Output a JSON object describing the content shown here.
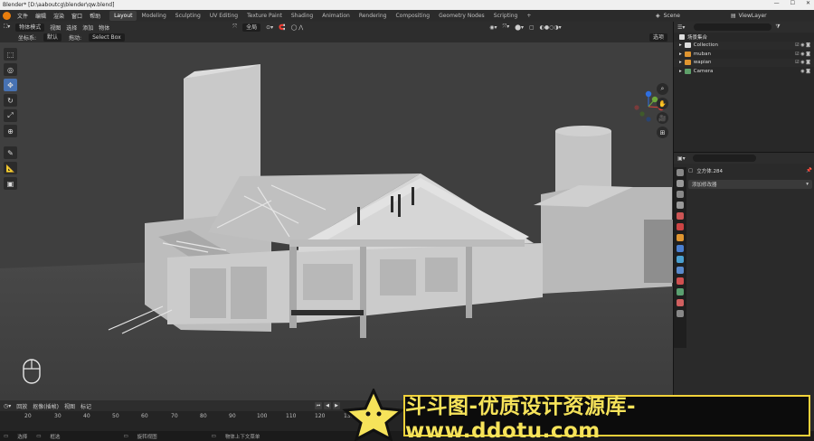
{
  "window": {
    "title": "Blender* [D:\\aaboutcg\\blender\\qw.blend]",
    "controls": [
      "—",
      "☐",
      "✕"
    ]
  },
  "menu": {
    "items": [
      "文件",
      "编辑",
      "渲染",
      "窗口",
      "帮助"
    ],
    "workspaces": [
      "Layout",
      "Modeling",
      "Sculpting",
      "UV Editing",
      "Texture Paint",
      "Shading",
      "Animation",
      "Rendering",
      "Compositing",
      "Geometry Nodes",
      "Scripting"
    ],
    "active_workspace": "Layout",
    "add_tab": "+",
    "scene": "Scene",
    "view_layer": "ViewLayer"
  },
  "viewport_header": {
    "mode": "物体模式",
    "menus": [
      "视图",
      "选择",
      "添加",
      "物体"
    ],
    "transform_orientation": "全局",
    "options": "选项"
  },
  "tool_header": {
    "orientation_label": "坐标系:",
    "orientation_value": "默认",
    "drag_label": "拖动:",
    "drag_value": "Select Box"
  },
  "toolbar": {
    "tools": [
      {
        "icon": "select-cursor-icon",
        "glyph": "⬚",
        "active": false
      },
      {
        "icon": "cursor-icon",
        "glyph": "◎",
        "active": false
      },
      {
        "icon": "move-icon",
        "glyph": "✥",
        "active": true
      },
      {
        "icon": "rotate-icon",
        "glyph": "↻",
        "active": false
      },
      {
        "icon": "scale-icon",
        "glyph": "⤢",
        "active": false
      },
      {
        "icon": "transform-icon",
        "glyph": "⊕",
        "active": false
      },
      {
        "icon": "annotate-icon",
        "glyph": "✎",
        "active": false
      },
      {
        "icon": "measure-icon",
        "glyph": "📐",
        "active": false
      },
      {
        "icon": "add-cube-icon",
        "glyph": "▣",
        "active": false
      }
    ]
  },
  "gizmo": {
    "axes": [
      {
        "label": "Z",
        "color": "#2f6fe0"
      },
      {
        "label": "X",
        "color": "#e0413a"
      },
      {
        "label": "Y",
        "color": "#6da83a"
      }
    ]
  },
  "nav_buttons": [
    {
      "icon": "zoom-icon",
      "glyph": "⌕"
    },
    {
      "icon": "pan-hand-icon",
      "glyph": "✋"
    },
    {
      "icon": "camera-view-icon",
      "glyph": "🎥"
    },
    {
      "icon": "grid-view-icon",
      "glyph": "⊞"
    }
  ],
  "outliner": {
    "title": "场景集合",
    "rows": [
      {
        "name": "Collection",
        "icon_color": "#ddd"
      },
      {
        "name": "muban",
        "icon_color": "#e09530"
      },
      {
        "name": "wapian",
        "icon_color": "#e09530"
      },
      {
        "name": "Camera",
        "icon_color": "#5fa06a"
      }
    ]
  },
  "properties": {
    "object_name": "立方体.284",
    "add_modifier": "添加修改器"
  },
  "timeline": {
    "menus": [
      "回放",
      "抠像(插帧)",
      "视图",
      "标记"
    ],
    "frames": [
      "20",
      "30",
      "40",
      "50",
      "60",
      "70",
      "80",
      "90",
      "100",
      "110",
      "120",
      "130"
    ]
  },
  "statusbar": {
    "items": [
      "选择",
      "框选",
      "旋转视图",
      "物体上下文菜单"
    ]
  },
  "watermark": {
    "text": "斗斗图-优质设计资源库-www.ddotu.com"
  }
}
